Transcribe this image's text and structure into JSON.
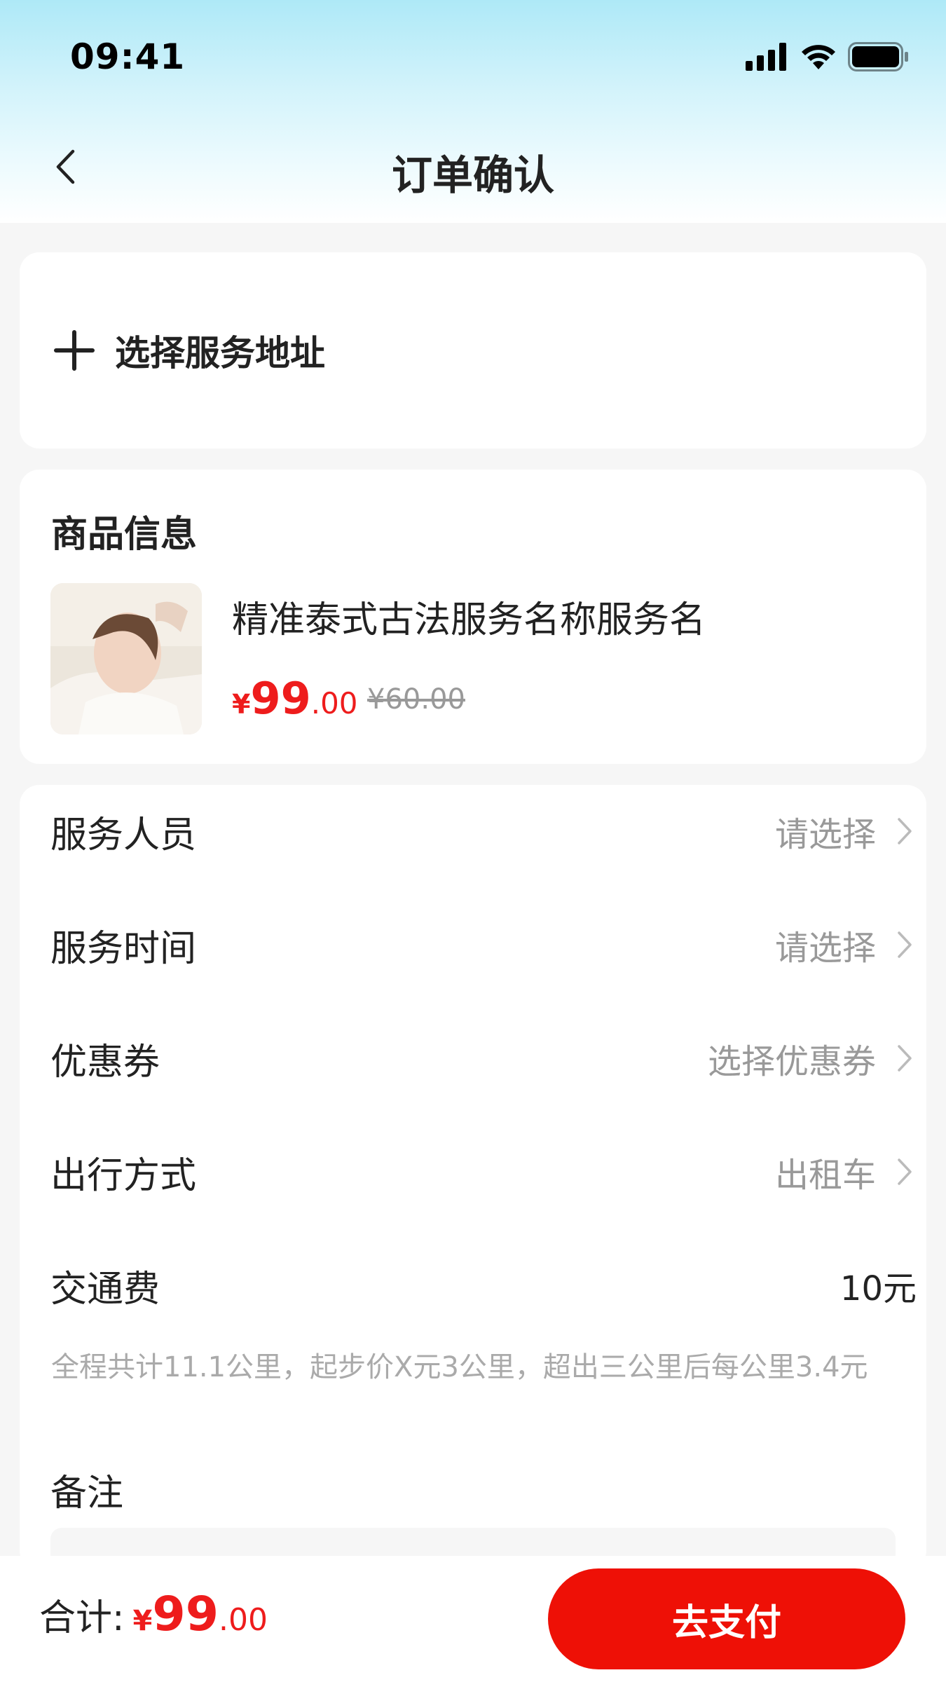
{
  "status_bar": {
    "time": "09:41"
  },
  "nav": {
    "title": "订单确认"
  },
  "address": {
    "label": "选择服务地址"
  },
  "goods": {
    "section_title": "商品信息",
    "name": "精准泰式古法服务名称服务名",
    "price_currency": "¥",
    "price_integer": "99",
    "price_decimal": ".00",
    "original_price": "¥60.00"
  },
  "form": {
    "staff": {
      "label": "服务人员",
      "value": "请选择"
    },
    "time": {
      "label": "服务时间",
      "value": "请选择"
    },
    "coupon": {
      "label": "优惠券",
      "value": "选择优惠券"
    },
    "travel": {
      "label": "出行方式",
      "value": "出租车"
    },
    "fare": {
      "label": "交通费",
      "value": "10元",
      "note": "全程共计11.1公里，起步价X元3公里，超出三公里后每公里3.4元"
    },
    "remark": {
      "label": "备注"
    }
  },
  "footer": {
    "total_label": "合计:",
    "total_currency": "¥",
    "total_integer": "99",
    "total_decimal": ".00",
    "pay_label": "去支付"
  },
  "colors": {
    "accent_red": "#ee1c1c",
    "pay_button": "#ee1006",
    "muted_text": "#999999"
  },
  "icons": [
    "signal-icon",
    "wifi-icon",
    "battery-icon",
    "back-arrow-icon",
    "plus-icon",
    "chevron-right-icon"
  ]
}
